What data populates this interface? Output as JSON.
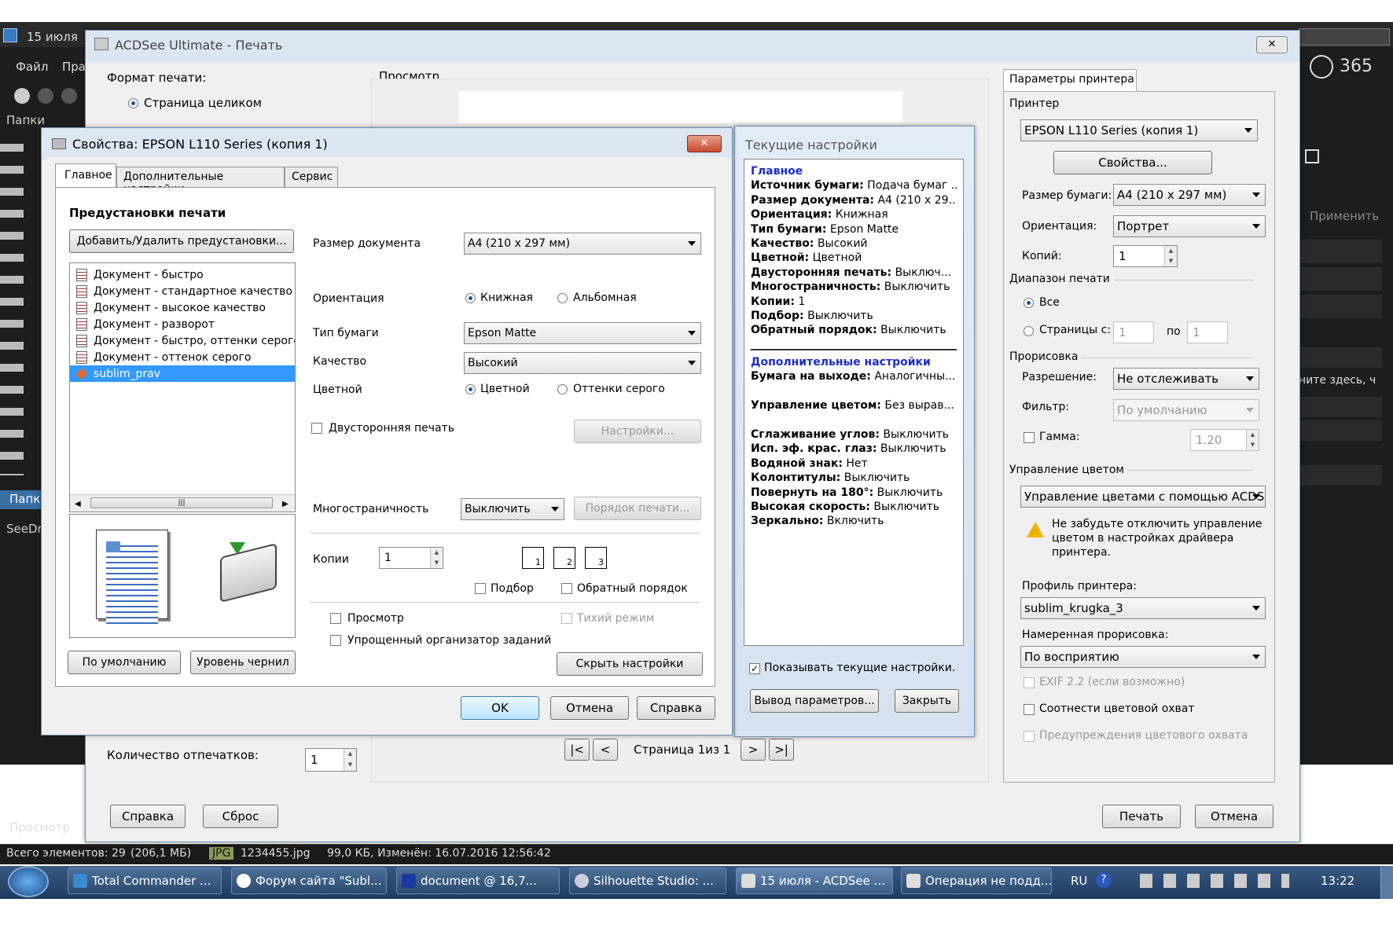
{
  "bg_app": {
    "tab_title": "15 июля",
    "menu_file": "Файл",
    "menu_edit": "Пра",
    "folders": "Папки",
    "folders2": "Папк",
    "seedrive": "SeeDri",
    "preview_tab": "Просмотр",
    "logo_365": "365",
    "apply": "Применить",
    "drop_here": "ните здесь, ч",
    "status_items": "Всего элементов: 29",
    "status_size": "(206,1 МБ)",
    "status_type": "JPG",
    "status_file": "1234455.jpg",
    "status_info": "99,0 КБ, Изменён: 16.07.2016 12:56:42"
  },
  "print_dialog": {
    "title": "ACDSee Ultimate - Печать",
    "print_format_label": "Формат печати:",
    "full_page": "Страница целиком",
    "preview_label": "Просмотр",
    "copies_label": "Количество отпечатков:",
    "copies_value": "1",
    "page_indicator": "Страница 1из 1",
    "help": "Справка",
    "reset": "Сброс",
    "print": "Печать",
    "cancel": "Отмена",
    "printer_params_tab": "Параметры принтера",
    "printer_section": "Принтер",
    "printer_name": "EPSON L110 Series (копия 1)",
    "properties_btn": "Свойства...",
    "paper_size_label": "Размер бумаги:",
    "paper_size_value": "A4 (210 x 297 мм)",
    "orientation_label": "Ориентация:",
    "orientation_value": "Портрет",
    "copies2_label": "Копий:",
    "copies2_value": "1",
    "range_section": "Диапазон печати",
    "range_all": "Все",
    "range_pages": "Страницы с:",
    "range_from": "1",
    "range_to_label": "по",
    "range_to": "1",
    "render_section": "Прорисовка",
    "resolution_label": "Разрешение:",
    "resolution_value": "Не отслеживать",
    "filter_label": "Фильтр:",
    "filter_value": "По умолчанию",
    "gamma_label": "Гамма:",
    "gamma_value": "1.20",
    "color_mgmt_section": "Управление цветом",
    "color_mgmt_value": "Управление цветами с помощью ACDSe",
    "warning_text_1": "Не забудьте отключить управление",
    "warning_text_2": "цветом в настройках драйвера",
    "warning_text_3": "принтера.",
    "profile_label": "Профиль принтера:",
    "profile_value": "sublim_krugka_3",
    "intent_label": "Намеренная прорисовка:",
    "intent_value": "По восприятию",
    "exif": "EXIF 2.2 (если возможно)",
    "gamut_map": "Соотнести цветовой охват",
    "gamut_warn": "Предупреждения цветового охвата"
  },
  "current_settings": {
    "title": "Текущие настройки",
    "main_header": "Главное",
    "main_items": [
      {
        "k": "Источник бумаги:",
        "v": " Подача бумаг ..."
      },
      {
        "k": "Размер документа:",
        "v": " A4 (210 x 29..."
      },
      {
        "k": "Ориентация:",
        "v": " Книжная"
      },
      {
        "k": "Тип бумаги:",
        "v": " Epson Matte"
      },
      {
        "k": "Качество:",
        "v": " Высокий"
      },
      {
        "k": "Цветной:",
        "v": " Цветной"
      },
      {
        "k": "Двусторонняя печать:",
        "v": " Выключ..."
      },
      {
        "k": "Многостраничность:",
        "v": " Выключить"
      },
      {
        "k": "Копии:",
        "v": " 1"
      },
      {
        "k": "Подбор:",
        "v": " Выключить"
      },
      {
        "k": "Обратный порядок:",
        "v": " Выключить"
      }
    ],
    "extra_header": "Дополнительные настройки",
    "extra_items": [
      {
        "k": "Бумага на выходе:",
        "v": " Аналогичны..."
      },
      {
        "k": "",
        "v": ""
      },
      {
        "k": "Управление цветом:",
        "v": " Без вырав..."
      },
      {
        "k": "",
        "v": ""
      },
      {
        "k": "Сглаживание углов:",
        "v": " Выключить"
      },
      {
        "k": "Исп. эф. крас. глаз:",
        "v": " Выключить"
      },
      {
        "k": "Водяной знак:",
        "v": " Нет"
      },
      {
        "k": "Колонтитулы:",
        "v": " Выключить"
      },
      {
        "k": "Повернуть на 180°:",
        "v": " Выключить"
      },
      {
        "k": "Высокая скорость:",
        "v": " Выключить"
      },
      {
        "k": "Зеркально:",
        "v": " Включить"
      }
    ],
    "show_checkbox": "Показывать текущие настройки.",
    "output_btn": "Вывод параметров...",
    "close_btn": "Закрыть"
  },
  "props": {
    "title": "Свойства: EPSON L110 Series (копия 1)",
    "tabs": [
      "Главное",
      "Дополнительные настройки",
      "Сервис"
    ],
    "presets_header": "Предустановки печати",
    "add_remove": "Добавить/Удалить предустановки...",
    "presets": [
      "Документ - быстро",
      "Документ - стандартное качество",
      "Документ - высокое качество",
      "Документ - разворот",
      "Документ - быстро, оттенки серого",
      "Документ - оттенок серого",
      "sublim_prav"
    ],
    "doc_size_label": "Размер документа",
    "doc_size_value": "A4 (210 x 297 мм)",
    "orientation_label": "Ориентация",
    "portrait": "Книжная",
    "landscape": "Альбомная",
    "paper_type_label": "Тип бумаги",
    "paper_type_value": "Epson Matte",
    "quality_label": "Качество",
    "quality_value": "Высокий",
    "color_label": "Цветной",
    "color_opt": "Цветной",
    "gray_opt": "Оттенки серого",
    "duplex": "Двусторонняя печать",
    "duplex_settings": "Настройки...",
    "multipage_label": "Многостраничность",
    "multipage_value": "Выключить",
    "print_order": "Порядок печати...",
    "copies_label": "Копии",
    "copies_value": "1",
    "collate": "Подбор",
    "reverse": "Обратный порядок",
    "preview": "Просмотр",
    "quiet": "Тихий режим",
    "job_arranger": "Упрощенный организатор заданий",
    "defaults": "По умолчанию",
    "ink_levels": "Уровень чернил",
    "hide_settings": "Скрыть настройки",
    "ok": "OK",
    "cancel": "Отмена",
    "help": "Справка"
  },
  "taskbar": {
    "items": [
      "Total Commander ...",
      "Форум сайта \"Subl...",
      "document @ 16,7...",
      "Silhouette Studio: ...",
      "15 июля - ACDSee ...",
      "Операция не подд..."
    ],
    "lang": "RU",
    "clock": "13:22"
  }
}
